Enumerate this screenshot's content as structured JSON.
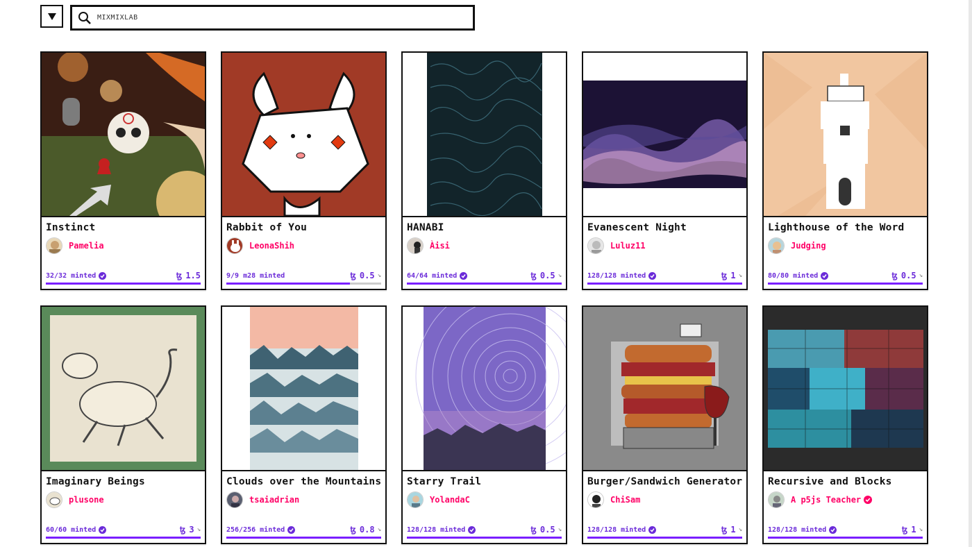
{
  "search": {
    "value": "MIXMIXLAB"
  },
  "colors": {
    "accent": "#7a1fff",
    "author": "#ff0066",
    "minted": "#6b2bd9"
  },
  "cards": [
    {
      "title": "Instinct",
      "author": "Pamelia",
      "minted": "32/32 minted",
      "price": "1.5",
      "progress": 1.0
    },
    {
      "title": "Rabbit of You",
      "author": "LeonaShih",
      "minted": "9/9 m28 minted",
      "price": "0.5",
      "progress": 0.8
    },
    {
      "title": "HANABI",
      "author": "Àisi",
      "minted": "64/64 minted",
      "price": "0.5",
      "progress": 1.0
    },
    {
      "title": "Evanescent Night",
      "author": "Luluz11",
      "minted": "128/128 minted",
      "price": "1",
      "progress": 1.0
    },
    {
      "title": "Lighthouse of the Word",
      "author": "Judging",
      "minted": "80/80 minted",
      "price": "0.5",
      "progress": 1.0
    },
    {
      "title": "Imaginary Beings",
      "author": "plusone",
      "minted": "60/60 minted",
      "price": "3",
      "progress": 1.0
    },
    {
      "title": "Clouds over the Mountains",
      "author": "tsaiadrian",
      "minted": "256/256 minted",
      "price": "0.8",
      "progress": 1.0
    },
    {
      "title": "Starry Trail",
      "author": "YolandaC",
      "minted": "128/128 minted",
      "price": "0.5",
      "progress": 1.0
    },
    {
      "title": "Burger/Sandwich Generator",
      "author": "ChiSam",
      "minted": "128/128 minted",
      "price": "1",
      "progress": 1.0
    },
    {
      "title": "Recursive and Blocks",
      "author": "A p5js Teacher",
      "minted": "128/128 minted",
      "price": "1",
      "progress": 1.0
    }
  ]
}
